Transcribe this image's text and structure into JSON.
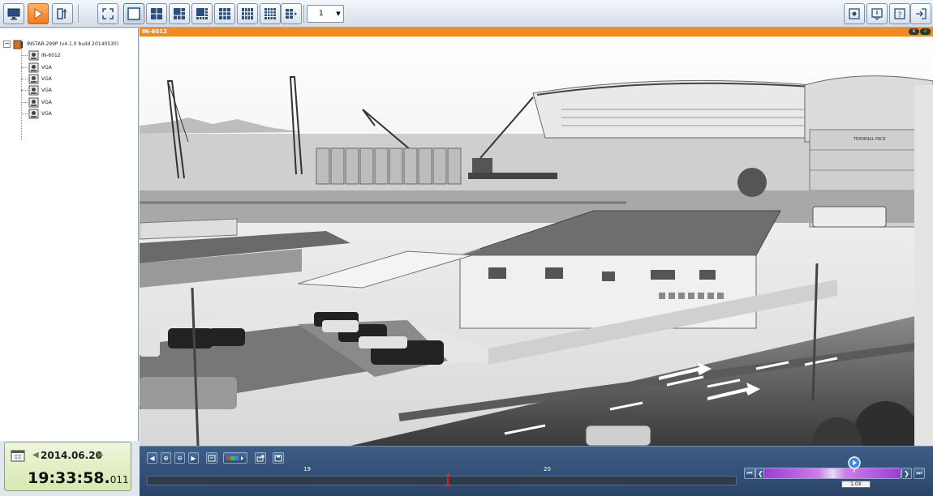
{
  "toolbar": {
    "page_select_value": "1"
  },
  "tree": {
    "root_label": "INSTAR-299P (v4.1.0 build 20140530)",
    "root_toggle": "−",
    "channels": [
      {
        "label": "IN-6012"
      },
      {
        "label": "VGA"
      },
      {
        "label": "VGA"
      },
      {
        "label": "VGA"
      },
      {
        "label": "VGA"
      },
      {
        "label": "VGA"
      }
    ]
  },
  "datetime": {
    "date": "2014.06.20",
    "time": "19:33:58.",
    "milliseconds": "011",
    "prev_arrow": "◀",
    "next_arrow": "▶"
  },
  "video": {
    "channel_title": "IN-6012",
    "status_rec": "R",
    "status_signal": "ıll",
    "sign_text": "TERMINAL PACE"
  },
  "playback": {
    "buttons": [
      "◀",
      "⊕",
      "⊖",
      "▶"
    ],
    "timeline_labels": [
      "19",
      "20"
    ],
    "cursor_position": 0.51,
    "speed_label": "1.0X",
    "speed_prev": "❮",
    "speed_next": "❯",
    "skip_start": "⏮",
    "skip_end": "⏭"
  },
  "colors": {
    "accent_orange": "#f08a24",
    "toolbar_bg": "#dfe7ef",
    "playback_bg": "#2a4468"
  }
}
